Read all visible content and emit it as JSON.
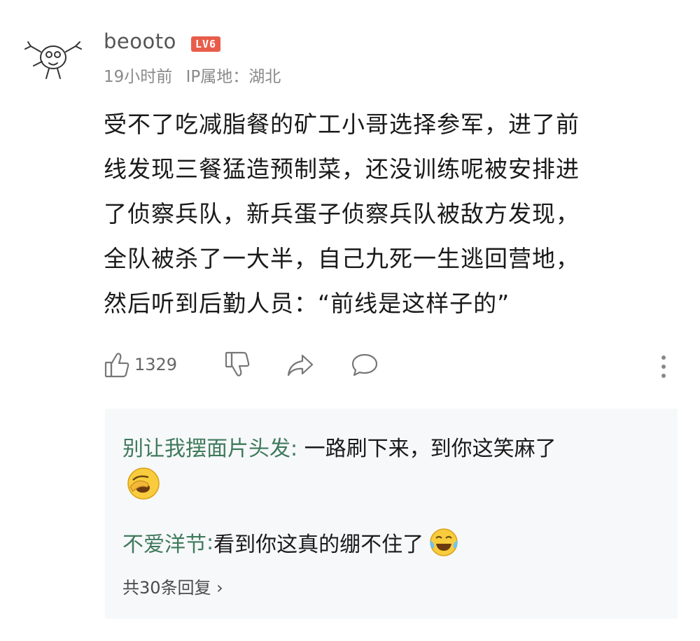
{
  "comment": {
    "user": {
      "name": "beooto",
      "level": "LV6",
      "avatar_icon": "doodle-avatar"
    },
    "meta": {
      "time": "19小时前",
      "ip_location": "IP属地：湖北"
    },
    "text_lines": [
      "受不了吃减脂餐的矿工小哥选择参军，进了前",
      "线发现三餐猛造预制菜，还没训练呢被安排进",
      "了侦察兵队，新兵蛋子侦察兵队被敌方发现，",
      "全队被杀了一大半，自己九死一生逃回营地，",
      "然后听到后勤人员：“前线是这样子的”"
    ],
    "actions": {
      "like_count": "1329",
      "like_icon": "thumb-up-icon",
      "dislike_icon": "thumb-down-icon",
      "share_icon": "share-icon",
      "comment_icon": "comment-bubble-icon",
      "more_icon": "more-vertical-icon"
    }
  },
  "replies": {
    "items": [
      {
        "author": "别让我摆面片头发",
        "separator": ": ",
        "text": "一路刷下来，到你这笑麻了",
        "emoji": "face-palm-laugh-emoji"
      },
      {
        "author": "不爱洋节",
        "separator": ": ",
        "text": "看到你这真的绷不住了",
        "emoji": "tears-of-joy-emoji"
      }
    ],
    "more_label": "共30条回复 ›"
  },
  "colors": {
    "reply_author": "#3f7a5c",
    "level_badge": "#e85d4a",
    "reply_bg": "#f7f8fa"
  }
}
